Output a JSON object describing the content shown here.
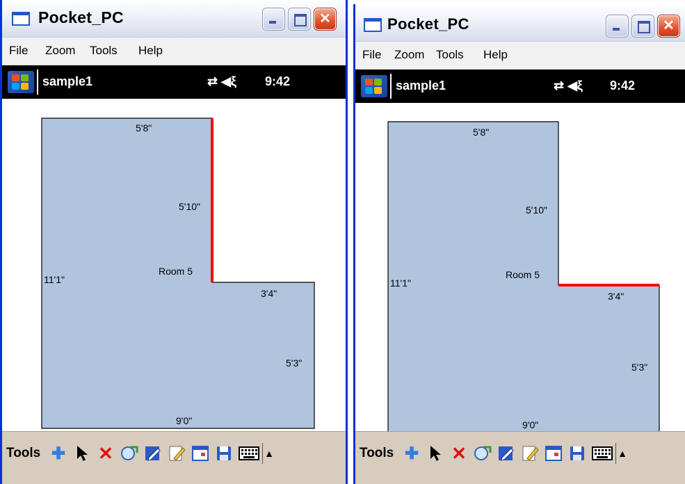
{
  "window": {
    "title": "Pocket_PC",
    "menu": [
      "File",
      "Zoom",
      "Tools",
      "Help"
    ],
    "status": {
      "document": "sample1",
      "icons": "⇄ ◀ξ",
      "time": "9:42"
    },
    "toolbar": {
      "label": "Tools",
      "tools": [
        "add-icon",
        "pointer-icon",
        "delete-icon",
        "explorer-icon",
        "pen-icon",
        "edit-document-icon",
        "window-icon",
        "save-icon",
        "keyboard-icon",
        "arrow-up-icon"
      ]
    }
  },
  "panels": [
    {
      "room": "Room 5",
      "highlighted_edge": "right-upper",
      "dimensions": {
        "top": "5'8\"",
        "right_upper": "5'10\"",
        "left": "11'1\"",
        "step": "3'4\"",
        "right_lower": "5'3\"",
        "bottom": "9'0\""
      }
    },
    {
      "room": "Room 5",
      "highlighted_edge": "step",
      "dimensions": {
        "top": "5'8\"",
        "right_upper": "5'10\"",
        "left": "11'1\"",
        "step": "3'4\"",
        "right_lower": "5'3\"",
        "bottom": "9'0\""
      }
    }
  ],
  "colors": {
    "room_fill": "#b0c4de",
    "highlight": "#ff0000",
    "title_bar_close": "#e3512b",
    "toolbar_bg": "#d7ccbe"
  }
}
